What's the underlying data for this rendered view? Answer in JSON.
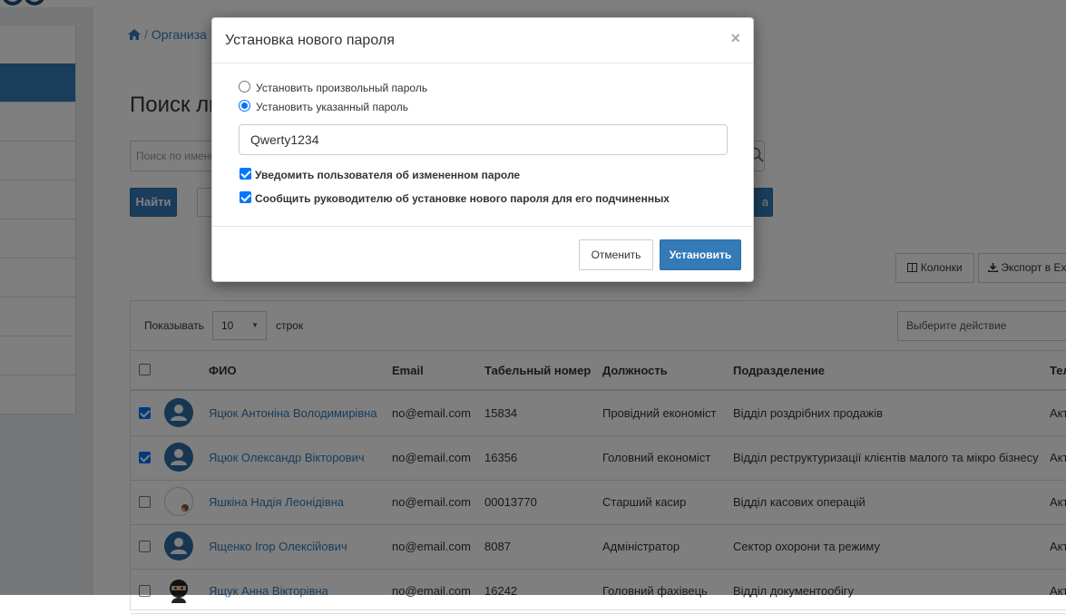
{
  "breadcrumb": {
    "home_icon": "home-icon",
    "current": "Организа"
  },
  "page": {
    "title": "Поиск лиц"
  },
  "search": {
    "placeholder": "Поиск по имени"
  },
  "buttons": {
    "find": "Найти",
    "right_fragment": "а",
    "columns": "Колонки",
    "export": "Экспорт в Ex"
  },
  "table_controls": {
    "show_label": "Показывать",
    "page_length": "10",
    "rows_label": "строк",
    "action_placeholder": "Выберите действие"
  },
  "table": {
    "headers": {
      "name": "ФИО",
      "email": "Email",
      "tab_number": "Табельный номер",
      "position": "Должность",
      "department": "Подразделение",
      "extra": "Тел"
    },
    "rows": [
      {
        "checked": true,
        "name": "Яцюк Антоніна Володимирівна",
        "email": "no@email.com",
        "tab_number": "15834",
        "position": "Провідний економіст",
        "department": "Відділ роздрібних продажів",
        "extra": "Акт"
      },
      {
        "checked": true,
        "name": "Яцюк Олександр Вікторович",
        "email": "no@email.com",
        "tab_number": "16356",
        "position": "Головний економіст",
        "department": "Відділ реструктуризації клієнтів малого та мікро бізнесу",
        "extra": "Акт"
      },
      {
        "checked": false,
        "name": "Яшкіна Надія Леонідівна",
        "email": "no@email.com",
        "tab_number": "00013770",
        "position": "Старший касир",
        "department": "Відділ касових операцій",
        "extra": "Акт"
      },
      {
        "checked": false,
        "name": "Ященко Ігор Олексійович",
        "email": "no@email.com",
        "tab_number": "8087",
        "position": "Адміністратор",
        "department": "Сектор охорони та режиму",
        "extra": "Акт"
      },
      {
        "checked": false,
        "name": "Ящук Анна Вікторівна",
        "email": "no@email.com",
        "tab_number": "16242",
        "position": "Головний фахівець",
        "department": "Відділ документообігу",
        "extra": "Акт"
      }
    ]
  },
  "modal": {
    "title": "Установка нового пароля",
    "close_symbol": "×",
    "radio_random": "Установить произвольный пароль",
    "radio_specified": "Установить указанный пароль",
    "password_value": "Qwerty1234",
    "notify_user": "Уведомить пользователя об измененном пароле",
    "notify_manager": "Сообщить руководителю об установке нового пароля для его подчиненных",
    "cancel": "Отменить",
    "submit": "Установить"
  },
  "colors": {
    "primary": "#337ab7",
    "link": "#337ab7",
    "check": "#0075ff"
  }
}
